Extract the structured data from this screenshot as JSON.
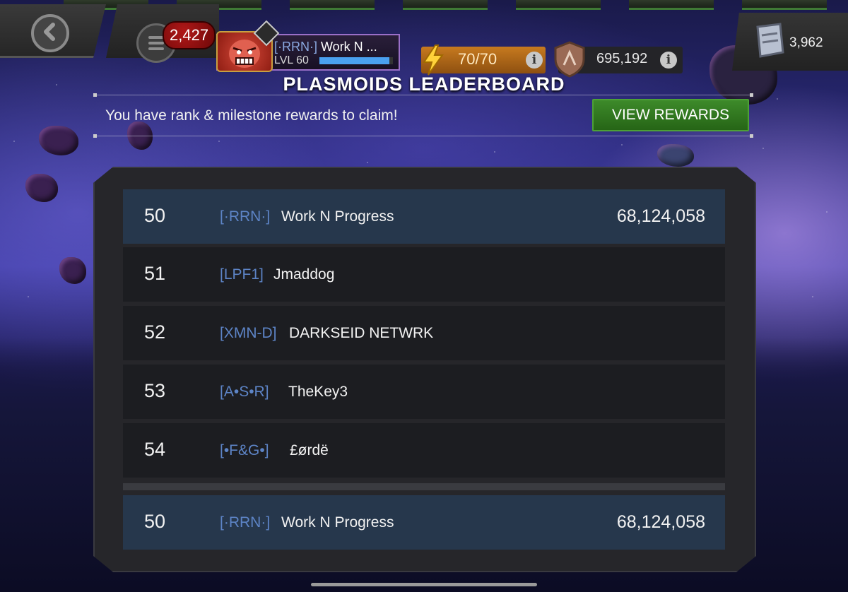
{
  "header": {
    "notification_count": "2,427",
    "profile": {
      "tag": "[·RRN·]",
      "name": "Work N ...",
      "level": "LVL 60",
      "xp_progress": 0.95
    },
    "energy": "70/70",
    "rating": "695,192",
    "currency": "3,962"
  },
  "title": "PLASMOIDS LEADERBOARD",
  "claim_message": "You have rank & milestone rewards to claim!",
  "view_rewards_label": "VIEW REWARDS",
  "leaderboard": {
    "rows": [
      {
        "rank": "50",
        "tag": "[·RRN·]",
        "name": "Work N Progress",
        "score": "68,124,058",
        "self": true
      },
      {
        "rank": "51",
        "tag": "[LPF1]",
        "name": "Jmaddog",
        "score": ""
      },
      {
        "rank": "52",
        "tag": "[XMN-D]",
        "name": "DARKSEID NETWRK",
        "score": ""
      },
      {
        "rank": "53",
        "tag": "[A•S•R]",
        "name": "TheKey3",
        "score": ""
      },
      {
        "rank": "54",
        "tag": "[•F&G•]",
        "name": "£ørdë",
        "score": ""
      }
    ],
    "pinned": {
      "rank": "50",
      "tag": "[·RRN·]",
      "name": "Work N Progress",
      "score": "68,124,058"
    }
  },
  "colors": {
    "view_rewards_bg": "#2f7a20",
    "self_row_bg": "#26374c",
    "row_bg": "#1c1d21",
    "tag_color": "#5d84c6",
    "energy_bg": "#b06a18"
  },
  "icons": [
    "back-arrow-icon",
    "menu-icon",
    "lightning-bolt-icon",
    "info-icon",
    "shield-icon",
    "currency-icon"
  ]
}
